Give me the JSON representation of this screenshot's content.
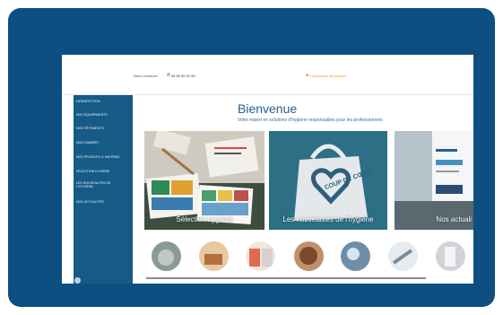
{
  "topbar": {
    "contact": "Nous contacter",
    "phone": "04 50 50 51 50",
    "promo": "Commande temporaire"
  },
  "sidebar": {
    "items": [
      "Desinfection",
      "Nos équipements",
      "Nos vêtements",
      "Nos gammes",
      "Nos produits & matériel",
      "Sélection hygiène",
      "Les nouveautés de l'hygiène",
      "Nos actualités"
    ]
  },
  "main": {
    "title": "Bienvenue",
    "subtitle": "Votre expert en solutions d'hygiène responsables pour les professionnels",
    "cards": [
      {
        "label": "Sélection hygiène"
      },
      {
        "label": "Les nouveautés de l'hygiène"
      },
      {
        "label": "Nos actuali"
      }
    ],
    "bag_text": "COUP DE CŒUR"
  },
  "colors": {
    "frame": "#0c4f80",
    "sidebar": "#175a86",
    "title": "#2b5d8a",
    "accent": "#e8a21a"
  },
  "icons": [
    "phone-icon",
    "cart-icon",
    "bag-heart-icon"
  ]
}
